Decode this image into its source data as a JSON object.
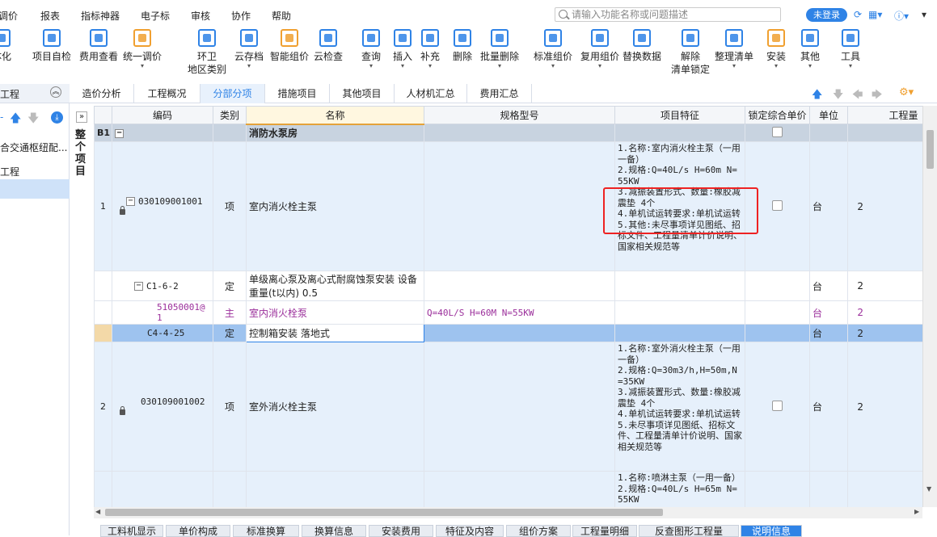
{
  "menu": {
    "items": [
      "调价",
      "报表",
      "指标神器",
      "电子标",
      "审核",
      "协作",
      "帮助"
    ],
    "search_placeholder": "请输入功能名称或问题描述",
    "login_label": "未登录"
  },
  "toolbar": {
    "items": [
      {
        "label": "体化",
        "icon": "integrate-icon",
        "color": "#2f83e6"
      },
      {
        "label": "项目自检",
        "icon": "self-check-icon",
        "color": "#2f83e6"
      },
      {
        "label": "费用查看",
        "icon": "cost-view-icon",
        "color": "#2f83e6"
      },
      {
        "label": "统一调价",
        "icon": "unified-price-icon",
        "color": "#f0a030",
        "caret": true
      },
      {
        "label": "环卫\n地区类别",
        "icon": "region-category-icon",
        "color": "#2f83e6"
      },
      {
        "label": "云存档",
        "icon": "cloud-archive-icon",
        "color": "#2f83e6",
        "caret": true
      },
      {
        "label": "智能组价",
        "icon": "smart-pricing-icon",
        "color": "#f0a030"
      },
      {
        "label": "云检查",
        "icon": "cloud-check-icon",
        "color": "#2f83e6"
      },
      {
        "label": "查询",
        "icon": "query-icon",
        "color": "#2f83e6",
        "caret": true
      },
      {
        "label": "插入",
        "icon": "insert-icon",
        "color": "#2f83e6",
        "caret": true
      },
      {
        "label": "补充",
        "icon": "supplement-icon",
        "color": "#2f83e6",
        "caret": true
      },
      {
        "label": "删除",
        "icon": "delete-icon",
        "color": "#2f83e6"
      },
      {
        "label": "批量删除",
        "icon": "batch-delete-icon",
        "color": "#2f83e6",
        "caret": true
      },
      {
        "label": "标准组价",
        "icon": "standard-pricing-icon",
        "color": "#2f83e6",
        "caret": true
      },
      {
        "label": "复用组价",
        "icon": "reuse-pricing-icon",
        "color": "#2f83e6",
        "caret": true
      },
      {
        "label": "替换数据",
        "icon": "replace-data-icon",
        "color": "#2f83e6"
      },
      {
        "label": "解除\n清单锁定",
        "icon": "unlock-list-icon",
        "color": "#2f83e6"
      },
      {
        "label": "整理清单",
        "icon": "organize-list-icon",
        "color": "#2f83e6",
        "caret": true
      },
      {
        "label": "安装",
        "icon": "install-icon",
        "color": "#f0a030",
        "caret": true
      },
      {
        "label": "其他",
        "icon": "other-icon",
        "color": "#2f83e6",
        "caret": true
      },
      {
        "label": "工具",
        "icon": "tools-icon",
        "color": "#2f83e6",
        "caret": true
      }
    ]
  },
  "left": {
    "header": "工程",
    "items": [
      "合交通枢纽配...",
      "工程"
    ]
  },
  "tabs": [
    "造价分析",
    "工程概况",
    "分部分项",
    "措施项目",
    "其他项目",
    "人材机汇总",
    "费用汇总"
  ],
  "active_tab": "分部分项",
  "sidebar_strip": "整个项目",
  "columns": [
    "",
    "编码",
    "类别",
    "名称",
    "规格型号",
    "项目特征",
    "锁定综合单价",
    "单位",
    "工程量"
  ],
  "rows": [
    {
      "type": "b1",
      "no": "B1",
      "code": "",
      "cat": "",
      "name": "消防水泵房",
      "spec": "",
      "feature": "",
      "unit": "",
      "qty": ""
    },
    {
      "type": "blue",
      "no": "1",
      "code": "030109001001",
      "cat": "项",
      "name": "室内消火栓主泵",
      "spec": "",
      "feature": "1.名称:室内消火栓主泵（一用一备）\n2.规格:Q=40L/s H=60m N=55KW\n3.减振装置形式、数量:橡胶减震垫 4个\n4.单机试运转要求:单机试运转\n5.其他:未尽事项详见图纸、招标文件、工程量清单计价说明、国家相关规范等",
      "unit": "台",
      "qty": "2"
    },
    {
      "type": "white",
      "no": "",
      "code": "C1-6-2",
      "cat": "定",
      "name": "单级离心泵及离心式耐腐蚀泵安装 设备重量(t以内) 0.5",
      "spec": "",
      "feature": "",
      "unit": "台",
      "qty": "2"
    },
    {
      "type": "white",
      "no": "",
      "code": "51050001@1",
      "cat": "主",
      "name": "室内消火栓泵",
      "spec": "Q=40L/S H=60M N=55KW",
      "feature": "",
      "unit": "台",
      "qty": "2"
    },
    {
      "type": "sel",
      "no": "",
      "code": "C4-4-25",
      "cat": "定",
      "name": "控制箱安装 落地式",
      "spec": "",
      "feature": "",
      "unit": "台",
      "qty": "2"
    },
    {
      "type": "blue",
      "no": "2",
      "code": "030109001002",
      "cat": "项",
      "name": "室外消火栓主泵",
      "spec": "",
      "feature": "1.名称:室外消火栓主泵（一用一备）\n2.规格:Q=30m3/h,H=50m,N=35KW\n3.减振装置形式、数量:橡胶减震垫 4个\n4.单机试运转要求:单机试运转\n5.未尽事项详见图纸、招标文件、工程量清单计价说明、国家相关规范等",
      "unit": "台",
      "qty": "2"
    },
    {
      "type": "blue",
      "no": "",
      "code": "",
      "cat": "",
      "name": "",
      "spec": "",
      "feature": "1.名称:喷淋主泵（一用一备）\n2.规格:Q=40L/s H=65m N=55KW",
      "unit": "",
      "qty": ""
    }
  ],
  "bottom_tabs": [
    "工料机显示",
    "单价构成",
    "标准换算",
    "换算信息",
    "安装费用",
    "特征及内容",
    "组价方案",
    "工程量明细",
    "反查图形工程量",
    "说明信息"
  ],
  "active_bottom_tab": "说明信息",
  "colors": {
    "accent": "#2f83e6",
    "highlight_box": "#e22222",
    "selected_row": "#9ec3ef"
  }
}
